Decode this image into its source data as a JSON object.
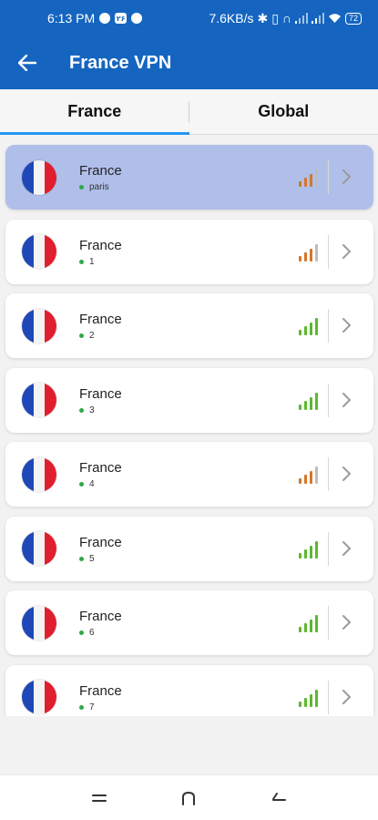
{
  "status_bar": {
    "time": "6:13 PM",
    "notif_badge": "۲۶",
    "speed": "7.6KB/s",
    "battery": "72"
  },
  "app_bar": {
    "title": "France VPN",
    "back_icon": "arrow-left-icon"
  },
  "tabs": [
    {
      "label": "France",
      "active": true
    },
    {
      "label": "Global",
      "active": false
    }
  ],
  "servers": [
    {
      "name": "France",
      "detail": "paris",
      "signal": "medium",
      "selected": true
    },
    {
      "name": "France",
      "detail": "1",
      "signal": "medium",
      "selected": false
    },
    {
      "name": "France",
      "detail": "2",
      "signal": "strong",
      "selected": false
    },
    {
      "name": "France",
      "detail": "3",
      "signal": "strong",
      "selected": false
    },
    {
      "name": "France",
      "detail": "4",
      "signal": "medium",
      "selected": false
    },
    {
      "name": "France",
      "detail": "5",
      "signal": "strong",
      "selected": false
    },
    {
      "name": "France",
      "detail": "6",
      "signal": "strong",
      "selected": false
    },
    {
      "name": "France",
      "detail": "7",
      "signal": "strong",
      "selected": false
    }
  ],
  "colors": {
    "primary": "#1565c0",
    "tab_indicator": "#2196f3",
    "selected_card": "#b0bfea",
    "signal_strong": "#5cb82e",
    "signal_medium": "#d4762a",
    "signal_inactive": "#bdbdbd",
    "online_dot": "#2ea84a"
  },
  "nav_bar": {
    "menu_icon": "menu-icon",
    "home_icon": "home-icon",
    "back_icon": "back-icon"
  }
}
